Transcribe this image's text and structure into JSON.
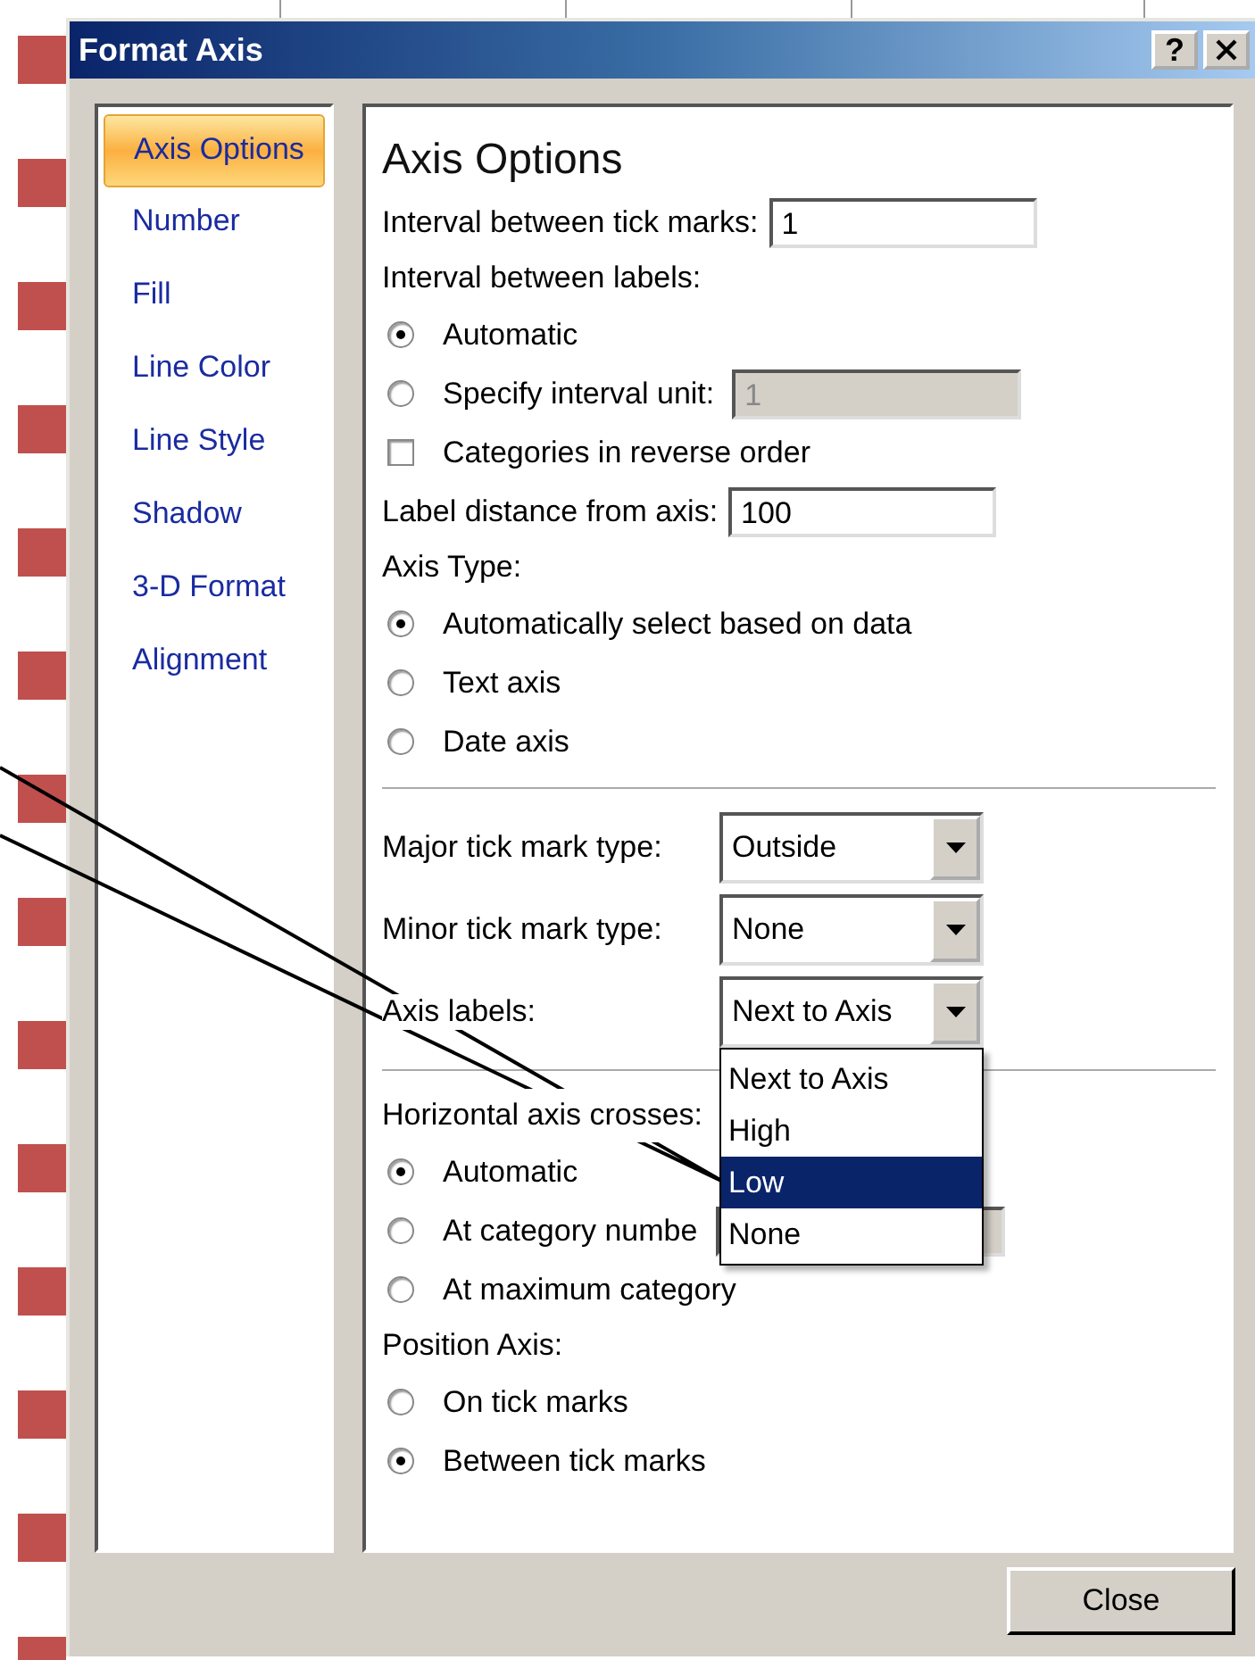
{
  "window": {
    "title": "Format Axis",
    "help_button": "?"
  },
  "nav": [
    {
      "label": "Axis Options",
      "selected": true
    },
    {
      "label": "Number",
      "selected": false
    },
    {
      "label": "Fill",
      "selected": false
    },
    {
      "label": "Line Color",
      "selected": false
    },
    {
      "label": "Line Style",
      "selected": false
    },
    {
      "label": "Shadow",
      "selected": false
    },
    {
      "label": "3-D Format",
      "selected": false
    },
    {
      "label": "Alignment",
      "selected": false
    }
  ],
  "panel": {
    "heading": "Axis Options",
    "rows": [
      {
        "kind": "field",
        "label": "Interval between tick marks:",
        "value": "1",
        "disabled": false
      },
      {
        "kind": "label",
        "label": "Interval between labels:"
      },
      {
        "kind": "radio",
        "label": "Automatic",
        "selected": true
      },
      {
        "kind": "radio",
        "label": "Specify interval unit:",
        "selected": false,
        "field_value": "1",
        "field_disabled": true
      },
      {
        "kind": "checkbox",
        "label": "Categories in reverse order",
        "checked": false
      },
      {
        "kind": "field",
        "label": "Label distance from axis:",
        "value": "100",
        "disabled": false
      },
      {
        "kind": "label",
        "label": "Axis Type:"
      },
      {
        "kind": "radio",
        "label": "Automatically select based on data",
        "selected": true
      },
      {
        "kind": "radio",
        "label": "Text axis",
        "selected": false
      },
      {
        "kind": "radio",
        "label": "Date axis",
        "selected": false
      },
      {
        "kind": "separator"
      },
      {
        "kind": "combo",
        "label": "Major tick mark type:",
        "value": "Outside"
      },
      {
        "kind": "combo",
        "label": "Minor tick mark type:",
        "value": "None"
      },
      {
        "kind": "combo",
        "label": "Axis labels:",
        "value": "Next to Axis",
        "open": true
      },
      {
        "kind": "separator"
      },
      {
        "kind": "label",
        "label": "Horizontal axis crosses:"
      },
      {
        "kind": "radio",
        "label": "Automatic",
        "selected": true
      },
      {
        "kind": "radio",
        "label": "At category numbe",
        "selected": false,
        "field_disabled": true
      },
      {
        "kind": "radio",
        "label": "At maximum category",
        "selected": false
      },
      {
        "kind": "label",
        "label": "Position Axis:"
      },
      {
        "kind": "radio",
        "label": "On tick marks",
        "selected": false
      },
      {
        "kind": "radio",
        "label": "Between tick marks",
        "selected": true
      }
    ]
  },
  "dropdown": [
    {
      "label": "Next to Axis",
      "selected": false
    },
    {
      "label": "High",
      "selected": false
    },
    {
      "label": "Low",
      "selected": true
    },
    {
      "label": "None",
      "selected": false
    }
  ],
  "close_button": "Close"
}
